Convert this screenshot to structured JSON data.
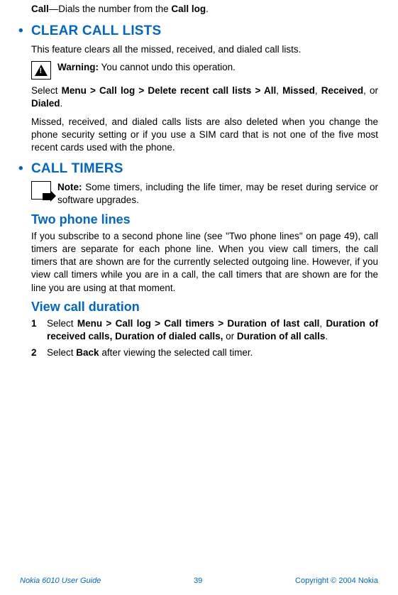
{
  "top": {
    "call_bold": "Call",
    "call_rest": "—Dials the number from the ",
    "call_log_bold": "Call log",
    "period": "."
  },
  "clear": {
    "heading": "CLEAR CALL LISTS",
    "intro": "This feature clears all the missed, received, and dialed call lists.",
    "warning_label": "Warning:",
    "warning_text": " You cannot undo this operation.",
    "select_prefix": "Select ",
    "select_path": "Menu > Call log > Delete recent call lists > All",
    "sep1": ", ",
    "missed": "Missed",
    "sep2": ", ",
    "received": "Received",
    "sep3": ", or ",
    "dialed": "Dialed",
    "select_suffix": ".",
    "explain": "Missed, received, and dialed calls lists are also deleted when you change the phone security setting or if you use a SIM card that is not one of the five most recent cards used with the phone."
  },
  "timers": {
    "heading": "CALL TIMERS",
    "note_label": "Note:",
    "note_text": " Some timers, including the life timer, may be reset during service or software upgrades.",
    "two_lines_heading": "Two phone lines",
    "two_lines_body": "If you subscribe to a second phone line (see \"Two phone lines\" on page 49), call timers are separate for each phone line. When you view call timers, the call timers that are shown are for the currently selected outgoing line. However, if you view call timers while you are in a call, the call timers that are shown are for the line you are using at that moment.",
    "view_heading": "View call duration",
    "step1_prefix": "Select ",
    "step1_path": "Menu > Call log > Call timers > Duration of last call",
    "step1_sep1": ", ",
    "step1_b2": "Duration of received calls, Duration of dialed calls,",
    "step1_sep2": " or ",
    "step1_b3": "Duration of all calls",
    "step1_suffix": ".",
    "step2_prefix": "Select ",
    "step2_bold": "Back",
    "step2_suffix": " after viewing the selected call timer."
  },
  "footer": {
    "left": "Nokia 6010 User Guide",
    "page": "39",
    "right": "Copyright © 2004 Nokia"
  }
}
